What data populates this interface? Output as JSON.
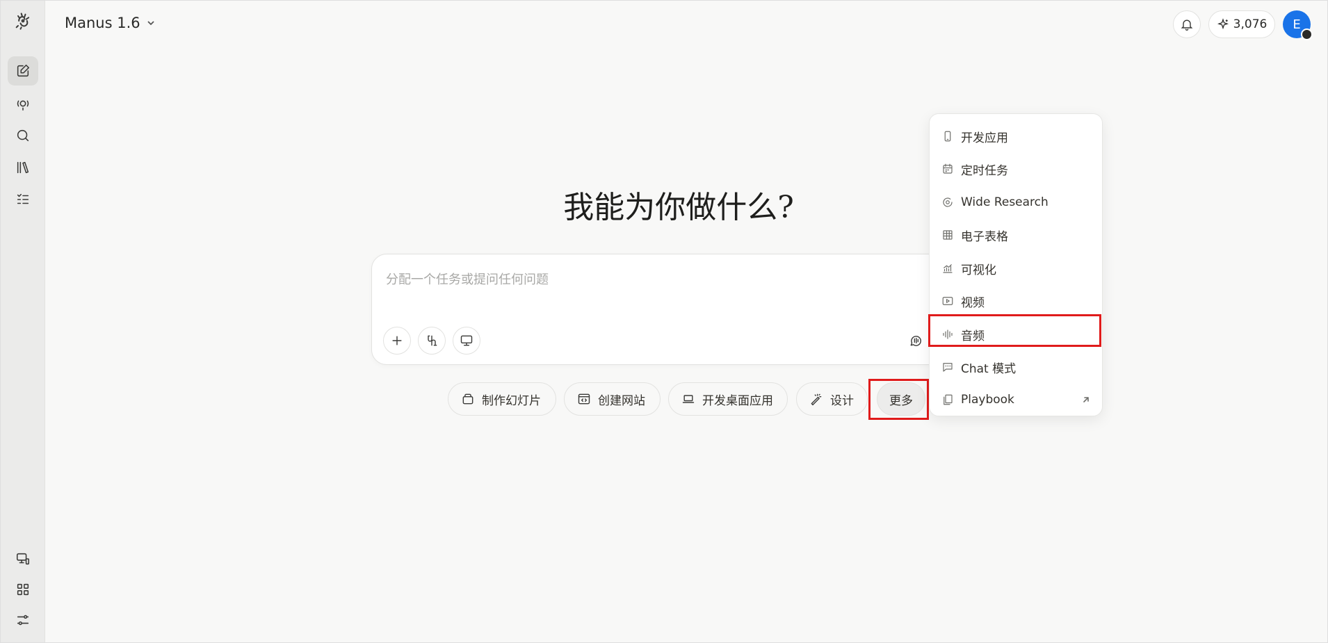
{
  "header": {
    "model_name": "Manus 1.6",
    "credits": "3,076",
    "avatar_letter": "E"
  },
  "main": {
    "headline": "我能为你做什么?",
    "input_placeholder": "分配一个任务或提问任何问题",
    "chips": [
      {
        "label": "制作幻灯片",
        "icon": "slides-icon"
      },
      {
        "label": "创建网站",
        "icon": "code-window-icon"
      },
      {
        "label": "开发桌面应用",
        "icon": "laptop-icon"
      },
      {
        "label": "设计",
        "icon": "magic-pen-icon"
      },
      {
        "label": "更多"
      }
    ]
  },
  "menu": {
    "items": [
      {
        "label": "开发应用",
        "icon": "mobile-icon"
      },
      {
        "label": "定时任务",
        "icon": "calendar-icon"
      },
      {
        "label": "Wide Research",
        "icon": "orbit-icon"
      },
      {
        "label": "电子表格",
        "icon": "table-icon"
      },
      {
        "label": "可视化",
        "icon": "chart-icon"
      },
      {
        "label": "视频",
        "icon": "video-icon"
      },
      {
        "label": "音频",
        "icon": "audio-wave-icon"
      },
      {
        "label": "Chat 模式",
        "icon": "chat-icon"
      },
      {
        "label": "Playbook",
        "icon": "playbook-icon"
      }
    ]
  },
  "colors": {
    "accent": "#1a73e8",
    "highlight": "#e01b1b",
    "background": "#f8f8f7"
  }
}
